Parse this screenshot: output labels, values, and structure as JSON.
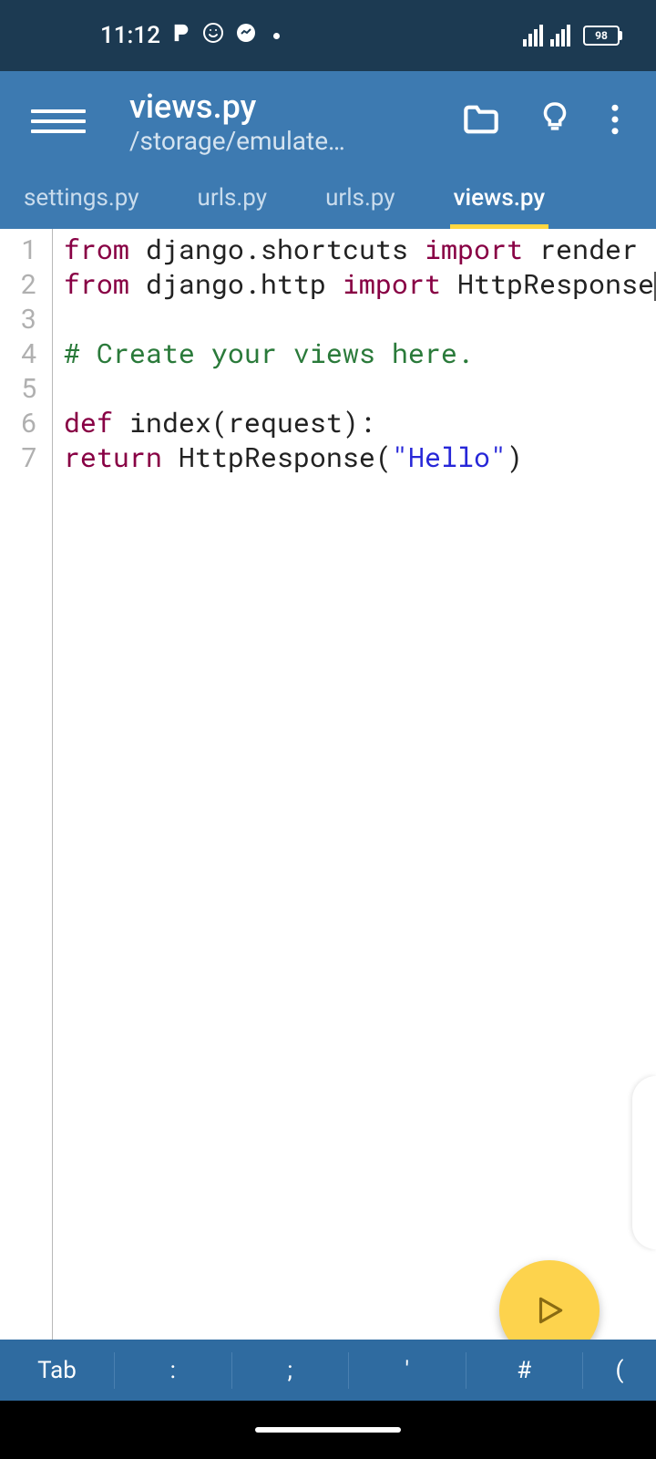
{
  "status": {
    "time": "11:12",
    "battery": "98"
  },
  "appbar": {
    "title": "views.py",
    "subtitle": "/storage/emulate…"
  },
  "tabs": [
    {
      "label": "settings.py",
      "active": false
    },
    {
      "label": "urls.py",
      "active": false
    },
    {
      "label": "urls.py",
      "active": false
    },
    {
      "label": "views.py",
      "active": true
    }
  ],
  "code": {
    "line1": {
      "kw1": "from",
      "mod": " django.shortcuts ",
      "kw2": "import",
      "name": " render"
    },
    "line2": {
      "kw1": "from",
      "mod": " django.http ",
      "kw2": "import",
      "name": " HttpResponse"
    },
    "line4_comment": "# Create your views here.",
    "line6": {
      "kw": "def",
      "rest": " index(request):"
    },
    "line7": {
      "indent": "    ",
      "kw": "return",
      "call1": " HttpResponse(",
      "str": "\"Hello\"",
      "call2": ")"
    }
  },
  "gutter": [
    "1",
    "2",
    "3",
    "4",
    "5",
    "6",
    "7"
  ],
  "bottombar": {
    "tab": "Tab",
    "colon": ":",
    "semicolon": ";",
    "quote": "'",
    "hash": "#",
    "paren": "("
  }
}
